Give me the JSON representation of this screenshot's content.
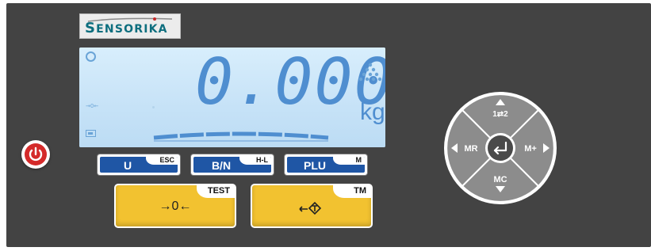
{
  "brand": {
    "name_first": "S",
    "name_rest": "ENSORIKA"
  },
  "display": {
    "weight": "0.000",
    "unit": "kg",
    "zero_indicator": "→0←"
  },
  "buttons": {
    "u": {
      "label": "U",
      "sub": "ESC"
    },
    "bn": {
      "label": "B/N",
      "sub": "H-L"
    },
    "plu": {
      "label": "PLU",
      "sub": "M"
    },
    "zero": {
      "label": "→0←",
      "sub": "TEST"
    },
    "tare": {
      "label": "↔T̂",
      "sub": "TM"
    }
  },
  "dpad": {
    "up": "1⇄2",
    "left": "MR",
    "right": "M+",
    "down": "MC"
  },
  "icons": [
    "power-icon",
    "enter-icon",
    "arrow-up-icon",
    "arrow-down-icon",
    "arrow-left-icon",
    "arrow-right-icon",
    "tare-icon"
  ],
  "colors": {
    "panel": "#434343",
    "lcd": "#cbe6f9",
    "lcd_digits": "#4f8ed0",
    "blue_key": "#1f56a5",
    "yellow_key": "#f2c230",
    "power": "#d42a2a",
    "brand": "#0d6e7e"
  }
}
